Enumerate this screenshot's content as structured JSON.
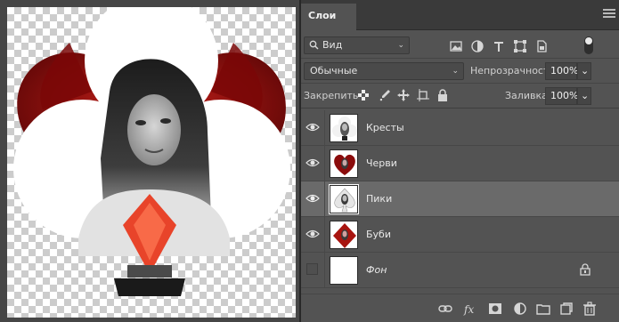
{
  "panel": {
    "tab_label": "Слои",
    "menu_icon": "panel-menu-icon"
  },
  "filter": {
    "kind_label": "Вид",
    "search_icon": "search-icon",
    "filter_icons": [
      "image-filter-icon",
      "adjustment-filter-icon",
      "type-filter-icon",
      "shape-filter-icon",
      "smart-object-filter-icon"
    ],
    "filter_toggle_state": "on"
  },
  "blend": {
    "mode": "Обычные",
    "opacity_label": "Непрозрачность:",
    "opacity_value": "100%"
  },
  "lock": {
    "label": "Закрепить:",
    "icons": [
      "lock-transparent-pixels-icon",
      "lock-image-pixels-icon",
      "lock-position-icon",
      "lock-artboard-icon",
      "lock-all-icon"
    ],
    "fill_label": "Заливка:",
    "fill_value": "100%"
  },
  "layers": [
    {
      "name": "Кресты",
      "visible": true,
      "selected": false,
      "thumb": "club"
    },
    {
      "name": "Черви",
      "visible": true,
      "selected": false,
      "thumb": "heart"
    },
    {
      "name": "Пики",
      "visible": true,
      "selected": true,
      "thumb": "spade"
    },
    {
      "name": "Буби",
      "visible": true,
      "selected": false,
      "thumb": "diamond"
    },
    {
      "name": "Фон",
      "visible": false,
      "selected": false,
      "thumb": "background",
      "locked": true
    }
  ],
  "footer_icons": [
    "link-layers-icon",
    "fx-icon",
    "add-mask-icon",
    "adjustment-layer-icon",
    "new-group-icon",
    "new-layer-icon",
    "delete-layer-icon"
  ],
  "colors": {
    "panel_bg": "#535353",
    "selected_row": "#6a6a6a",
    "card_red": "#8b0c0c",
    "accent_red": "#e8442a"
  }
}
